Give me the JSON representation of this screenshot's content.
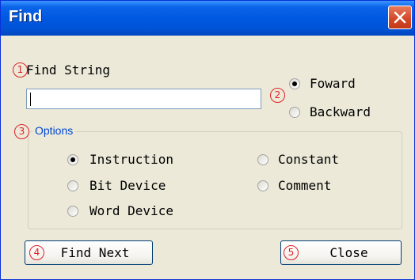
{
  "window": {
    "title": "Find"
  },
  "markers": [
    "1",
    "2",
    "3",
    "4",
    "5"
  ],
  "find_string": {
    "label": "Find String",
    "value": ""
  },
  "direction": {
    "options": [
      {
        "label": "Foward",
        "checked": true
      },
      {
        "label": "Backward",
        "checked": false
      }
    ]
  },
  "options": {
    "title": "Options",
    "items": [
      {
        "label": "Instruction",
        "checked": true
      },
      {
        "label": "Bit Device",
        "checked": false
      },
      {
        "label": "Word Device",
        "checked": false
      },
      {
        "label": "Constant",
        "checked": false
      },
      {
        "label": "Comment",
        "checked": false
      }
    ]
  },
  "buttons": {
    "find_next": "Find Next",
    "close": "Close"
  },
  "colors": {
    "title_bar": "#0058e0",
    "marker": "#e0202a",
    "group_title": "#0046d5",
    "dialog_bg": "#ece9d8"
  },
  "icons": [
    "close-icon",
    "radio-selected-icon",
    "radio-unselected-icon"
  ]
}
